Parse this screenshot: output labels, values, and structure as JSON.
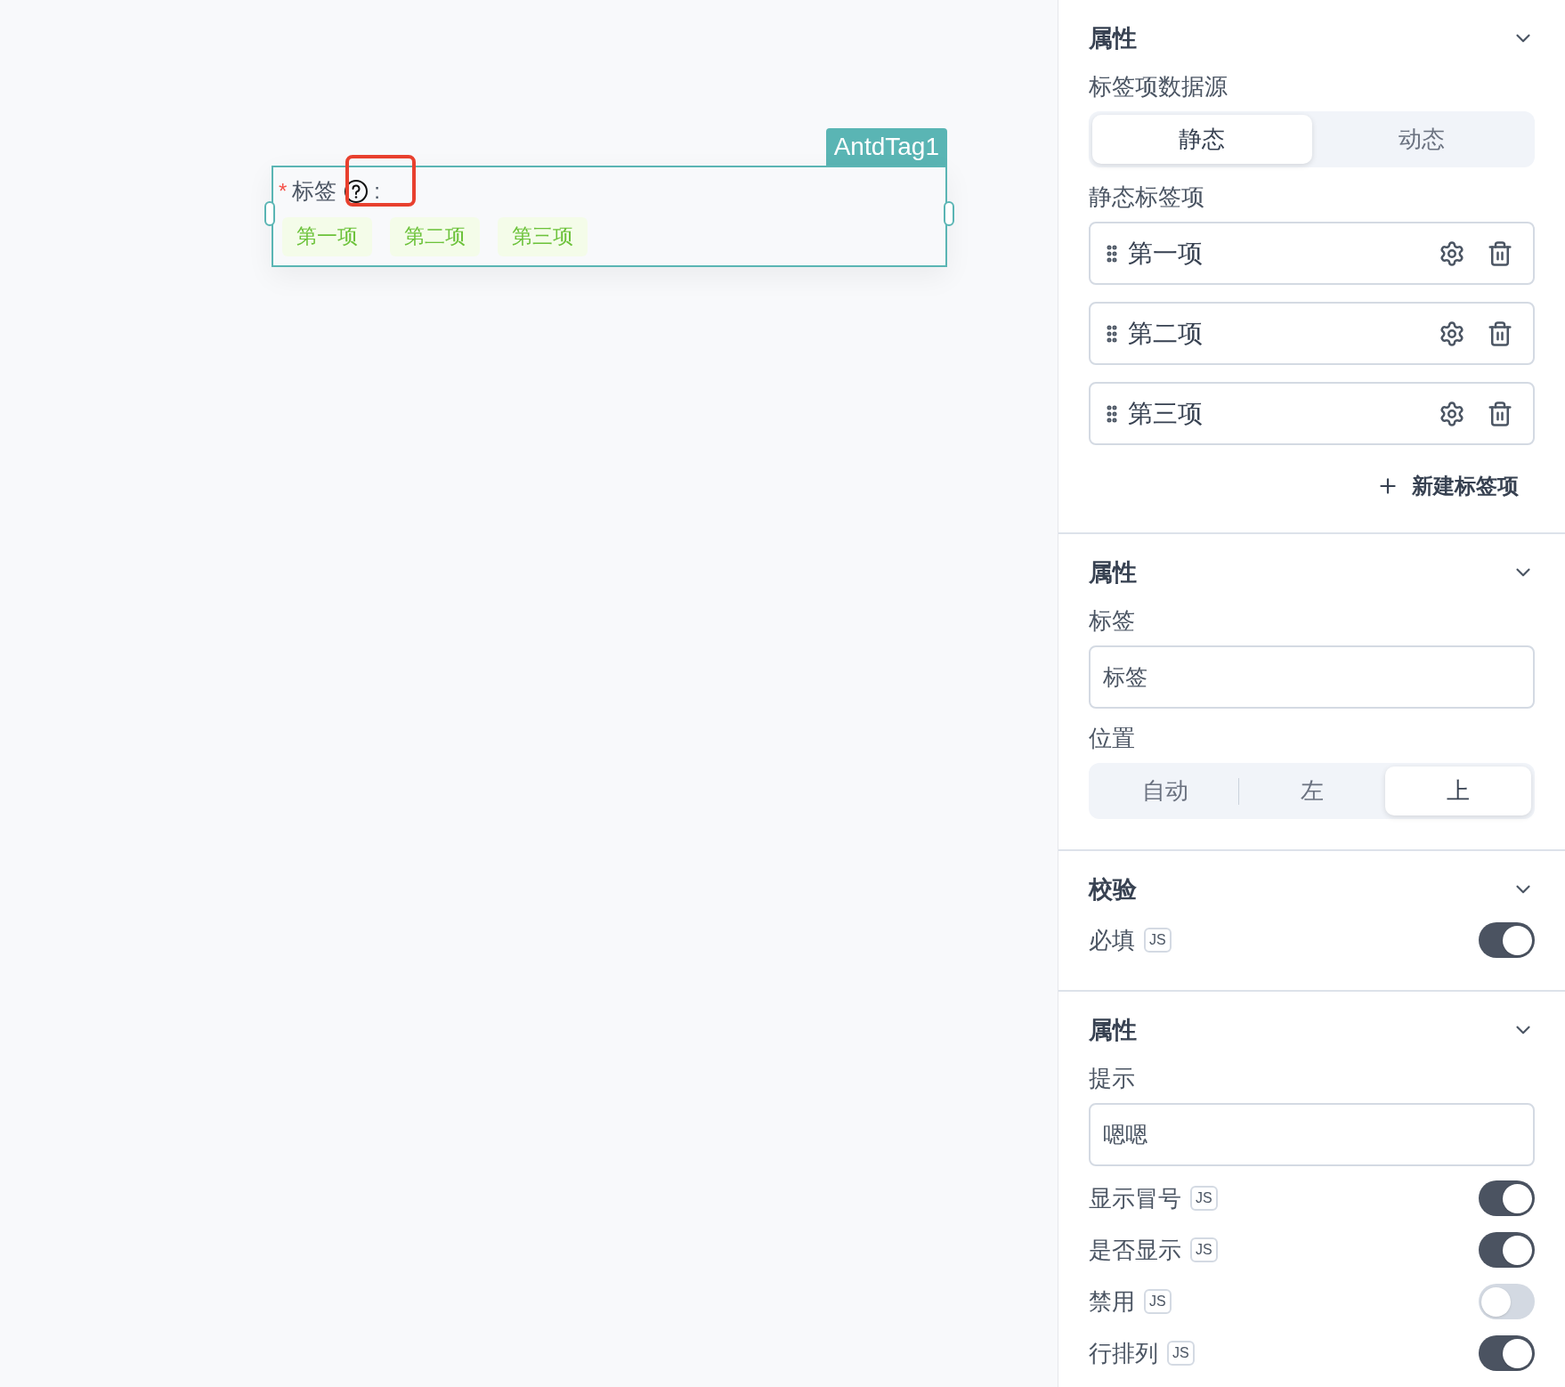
{
  "canvas": {
    "component_tag": "AntdTag1",
    "field": {
      "required_mark": "*",
      "label": "标签",
      "colon": ":",
      "highlighted_help": true,
      "tags": [
        "第一项",
        "第二项",
        "第三项"
      ]
    }
  },
  "panel": {
    "sections": [
      {
        "title": "属性",
        "rows": [
          {
            "kind": "segmented",
            "label": "标签项数据源",
            "options": [
              {
                "label": "静态",
                "selected": true
              },
              {
                "label": "动态",
                "selected": false
              }
            ]
          },
          {
            "kind": "list",
            "label": "静态标签项",
            "items": [
              "第一项",
              "第二项",
              "第三项"
            ]
          },
          {
            "kind": "add",
            "label": "新建标签项"
          }
        ]
      },
      {
        "title": "属性",
        "rows": [
          {
            "kind": "input",
            "label": "标签",
            "value": "标签"
          },
          {
            "kind": "segmented",
            "label": "位置",
            "options": [
              {
                "label": "自动",
                "selected": false
              },
              {
                "label": "左",
                "selected": false
              },
              {
                "label": "上",
                "selected": true
              }
            ]
          }
        ]
      },
      {
        "title": "校验",
        "rows": [
          {
            "kind": "toggle",
            "label": "必填",
            "badge": "JS",
            "on": true
          }
        ]
      },
      {
        "title": "属性",
        "rows": [
          {
            "kind": "input",
            "label": "提示",
            "value": "嗯嗯"
          },
          {
            "kind": "toggle",
            "label": "显示冒号",
            "badge": "JS",
            "on": true
          },
          {
            "kind": "toggle",
            "label": "是否显示",
            "badge": "JS",
            "on": true
          },
          {
            "kind": "toggle",
            "label": "禁用",
            "badge": "JS",
            "on": false
          },
          {
            "kind": "toggle",
            "label": "行排列",
            "badge": "JS",
            "on": true
          }
        ]
      }
    ]
  }
}
